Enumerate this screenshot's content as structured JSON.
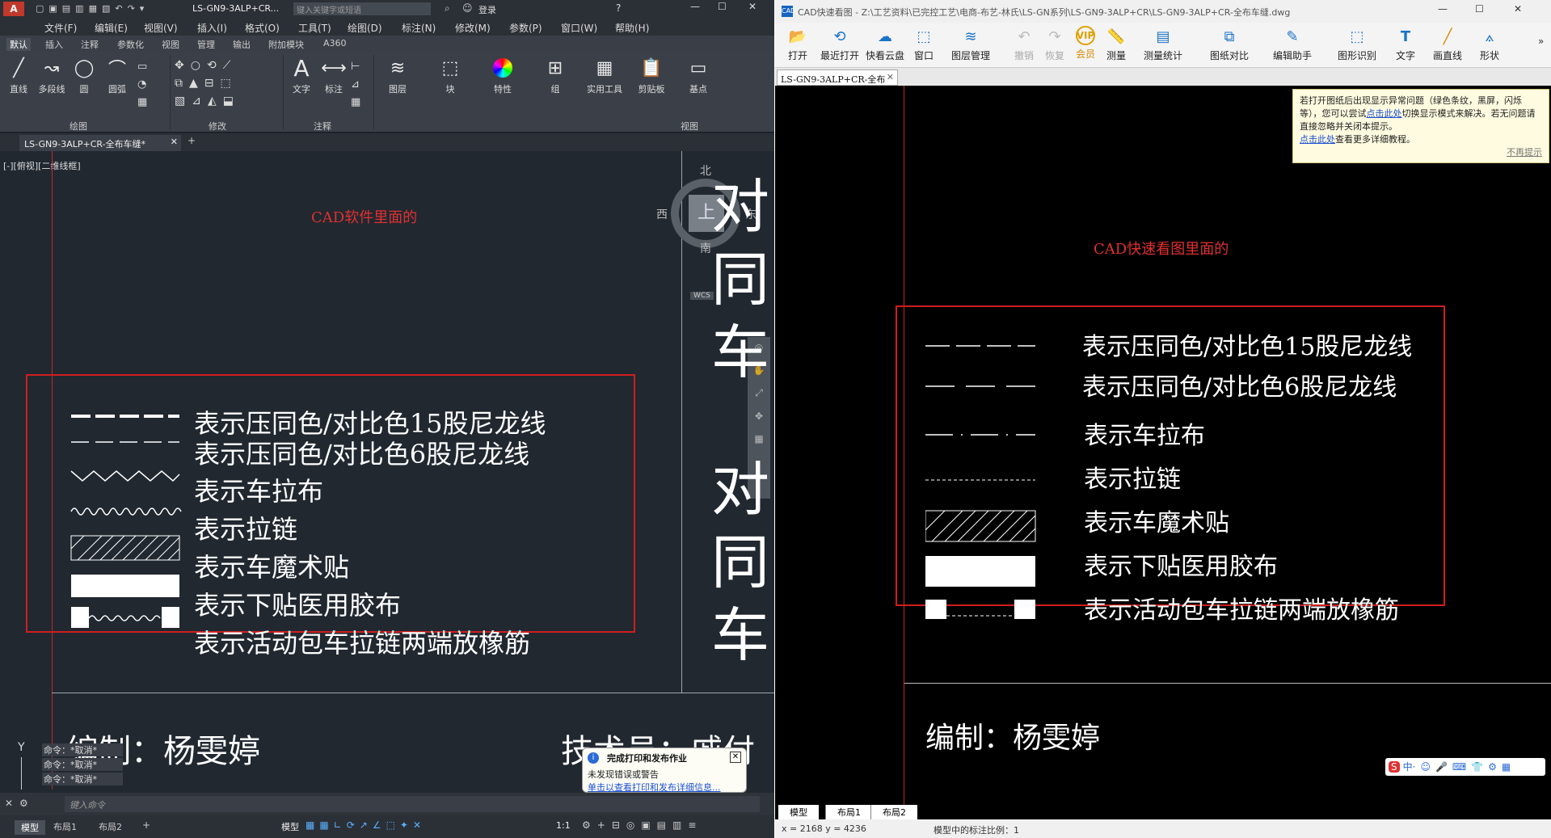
{
  "acad": {
    "title": "LS-GN9-3ALP+CR...",
    "search_placeholder": "键入关键字或短语",
    "login": "登录",
    "menu": [
      "文件(F)",
      "编辑(E)",
      "视图(V)",
      "插入(I)",
      "格式(O)",
      "工具(T)",
      "绘图(D)",
      "标注(N)",
      "修改(M)",
      "参数(P)",
      "窗口(W)",
      "帮助(H)"
    ],
    "ribbon_tabs": [
      "默认",
      "插入",
      "注释",
      "参数化",
      "视图",
      "管理",
      "输出",
      "附加模块",
      "A360"
    ],
    "ribbon_buttons": {
      "line": "直线",
      "polyline": "多段线",
      "circle": "圆",
      "arc": "圆弧",
      "text": "文字",
      "dim": "标注",
      "layer": "图层",
      "block": "块",
      "props": "特性",
      "group": "组",
      "utils": "实用工具",
      "clipboard": "剪贴板",
      "base": "基点"
    },
    "ribbon_groups": {
      "draw": "绘图",
      "modify": "修改",
      "annotate": "注释",
      "view": "视图"
    },
    "doc_tab": "LS-GN9-3ALP+CR-全布车缝*",
    "viewport_label": "[-][俯视][二维线框]",
    "compass": {
      "n": "北",
      "s": "南",
      "w": "西",
      "e": "东",
      "top": "上",
      "wcs": "WCS"
    },
    "caption": "CAD软件里面的",
    "legend": [
      "表示压同色/对比色15股尼龙线",
      "表示压同色/对比色6股尼龙线",
      "表示车拉布",
      "表示拉链",
      "表示车魔术贴",
      "表示下贴医用胶布",
      "表示活动包车拉链两端放橡筋"
    ],
    "big_chars": [
      "对",
      "同",
      "车",
      "对",
      "同",
      "车"
    ],
    "editor": "编制：杨雯婷",
    "tech": "技术员：戚付",
    "cmd_history": [
      "命令：*取消*",
      "命令：*取消*",
      "命令：*取消*"
    ],
    "cmd_placeholder": "键入命令",
    "y_axis": "Y",
    "layout_tabs": [
      "模型",
      "布局1",
      "布局2"
    ],
    "status_model": "模型",
    "status_scale": "1:1",
    "notify": {
      "title": "完成打印和发布作业",
      "body": "未发现错误或警告",
      "link": "单击以查看打印和发布详细信息..."
    }
  },
  "viewer": {
    "title": "CAD快速看图 - Z:\\工艺资料\\已完控工艺\\电商-布艺-林氏\\LS-GN系列\\LS-GN9-3ALP+CR\\LS-GN9-3ALP+CR-全布车缝.dwg",
    "toolbar": [
      "打开",
      "最近打开",
      "快看云盘",
      "窗口",
      "图层管理",
      "撤销",
      "恢复",
      "会员",
      "测量",
      "测量统计",
      "图纸对比",
      "编辑助手",
      "图形识别",
      "文字",
      "画直线",
      "形状"
    ],
    "doc_tab": "LS-GN9-3ALP+CR-全布",
    "notice": {
      "text1": "若打开图纸后出现显示异常问题（绿色条纹，黑屏，闪烁等），您可以尝试",
      "link1": "点击此处",
      "text2": "切换显示模式来解决。若无问题请直接忽略并关闭本提示。",
      "link2": "点击此处",
      "text3": "查看更多详细教程。",
      "dismiss": "不再提示"
    },
    "caption": "CAD快速看图里面的",
    "legend": [
      "表示压同色/对比色15股尼龙线",
      "表示压同色/对比色6股尼龙线",
      "表示车拉布",
      "表示拉链",
      "表示车魔术贴",
      "表示下贴医用胶布",
      "表示活动包车拉链两端放橡筋"
    ],
    "editor": "编制：杨雯婷",
    "layout_tabs": [
      "模型",
      "布局1",
      "布局2"
    ],
    "coords": "x = 2168  y = 4236",
    "scale": "模型中的标注比例：1",
    "ime": "中"
  }
}
